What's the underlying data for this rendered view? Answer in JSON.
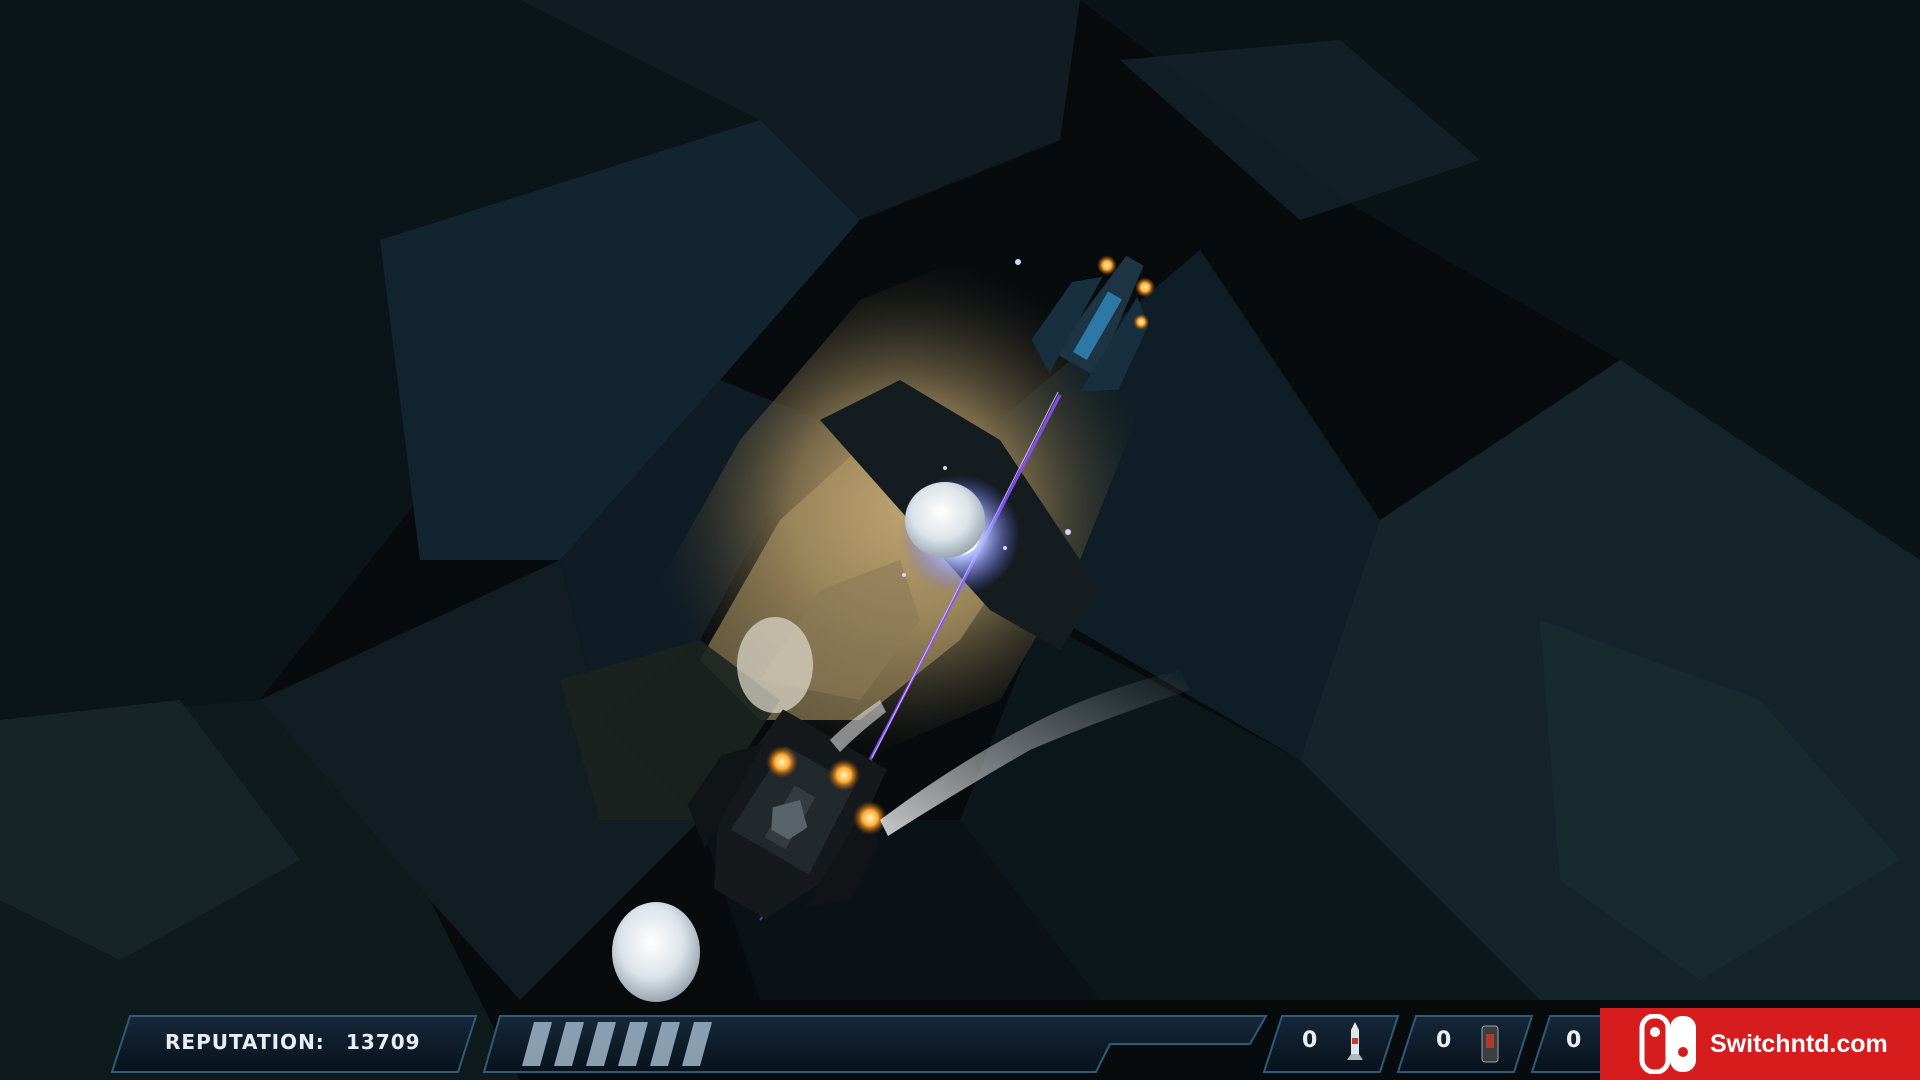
{
  "hud": {
    "reputation_label": "REPUTATION:",
    "reputation_value": "13709",
    "shield_segments_filled": 6,
    "slots": [
      {
        "count": "0",
        "icon": "missile-icon"
      },
      {
        "count": "0",
        "icon": "mine-icon"
      },
      {
        "count": "0",
        "icon": "bomb-icon"
      }
    ]
  },
  "watermark": {
    "text": "Switchntd.com",
    "color": "#d61c1c"
  },
  "scene": {
    "colors": {
      "rock": "#13202a",
      "light": "#b89e6d",
      "laser": "#8a4dff",
      "exhaust": "#ff9a2a"
    }
  }
}
